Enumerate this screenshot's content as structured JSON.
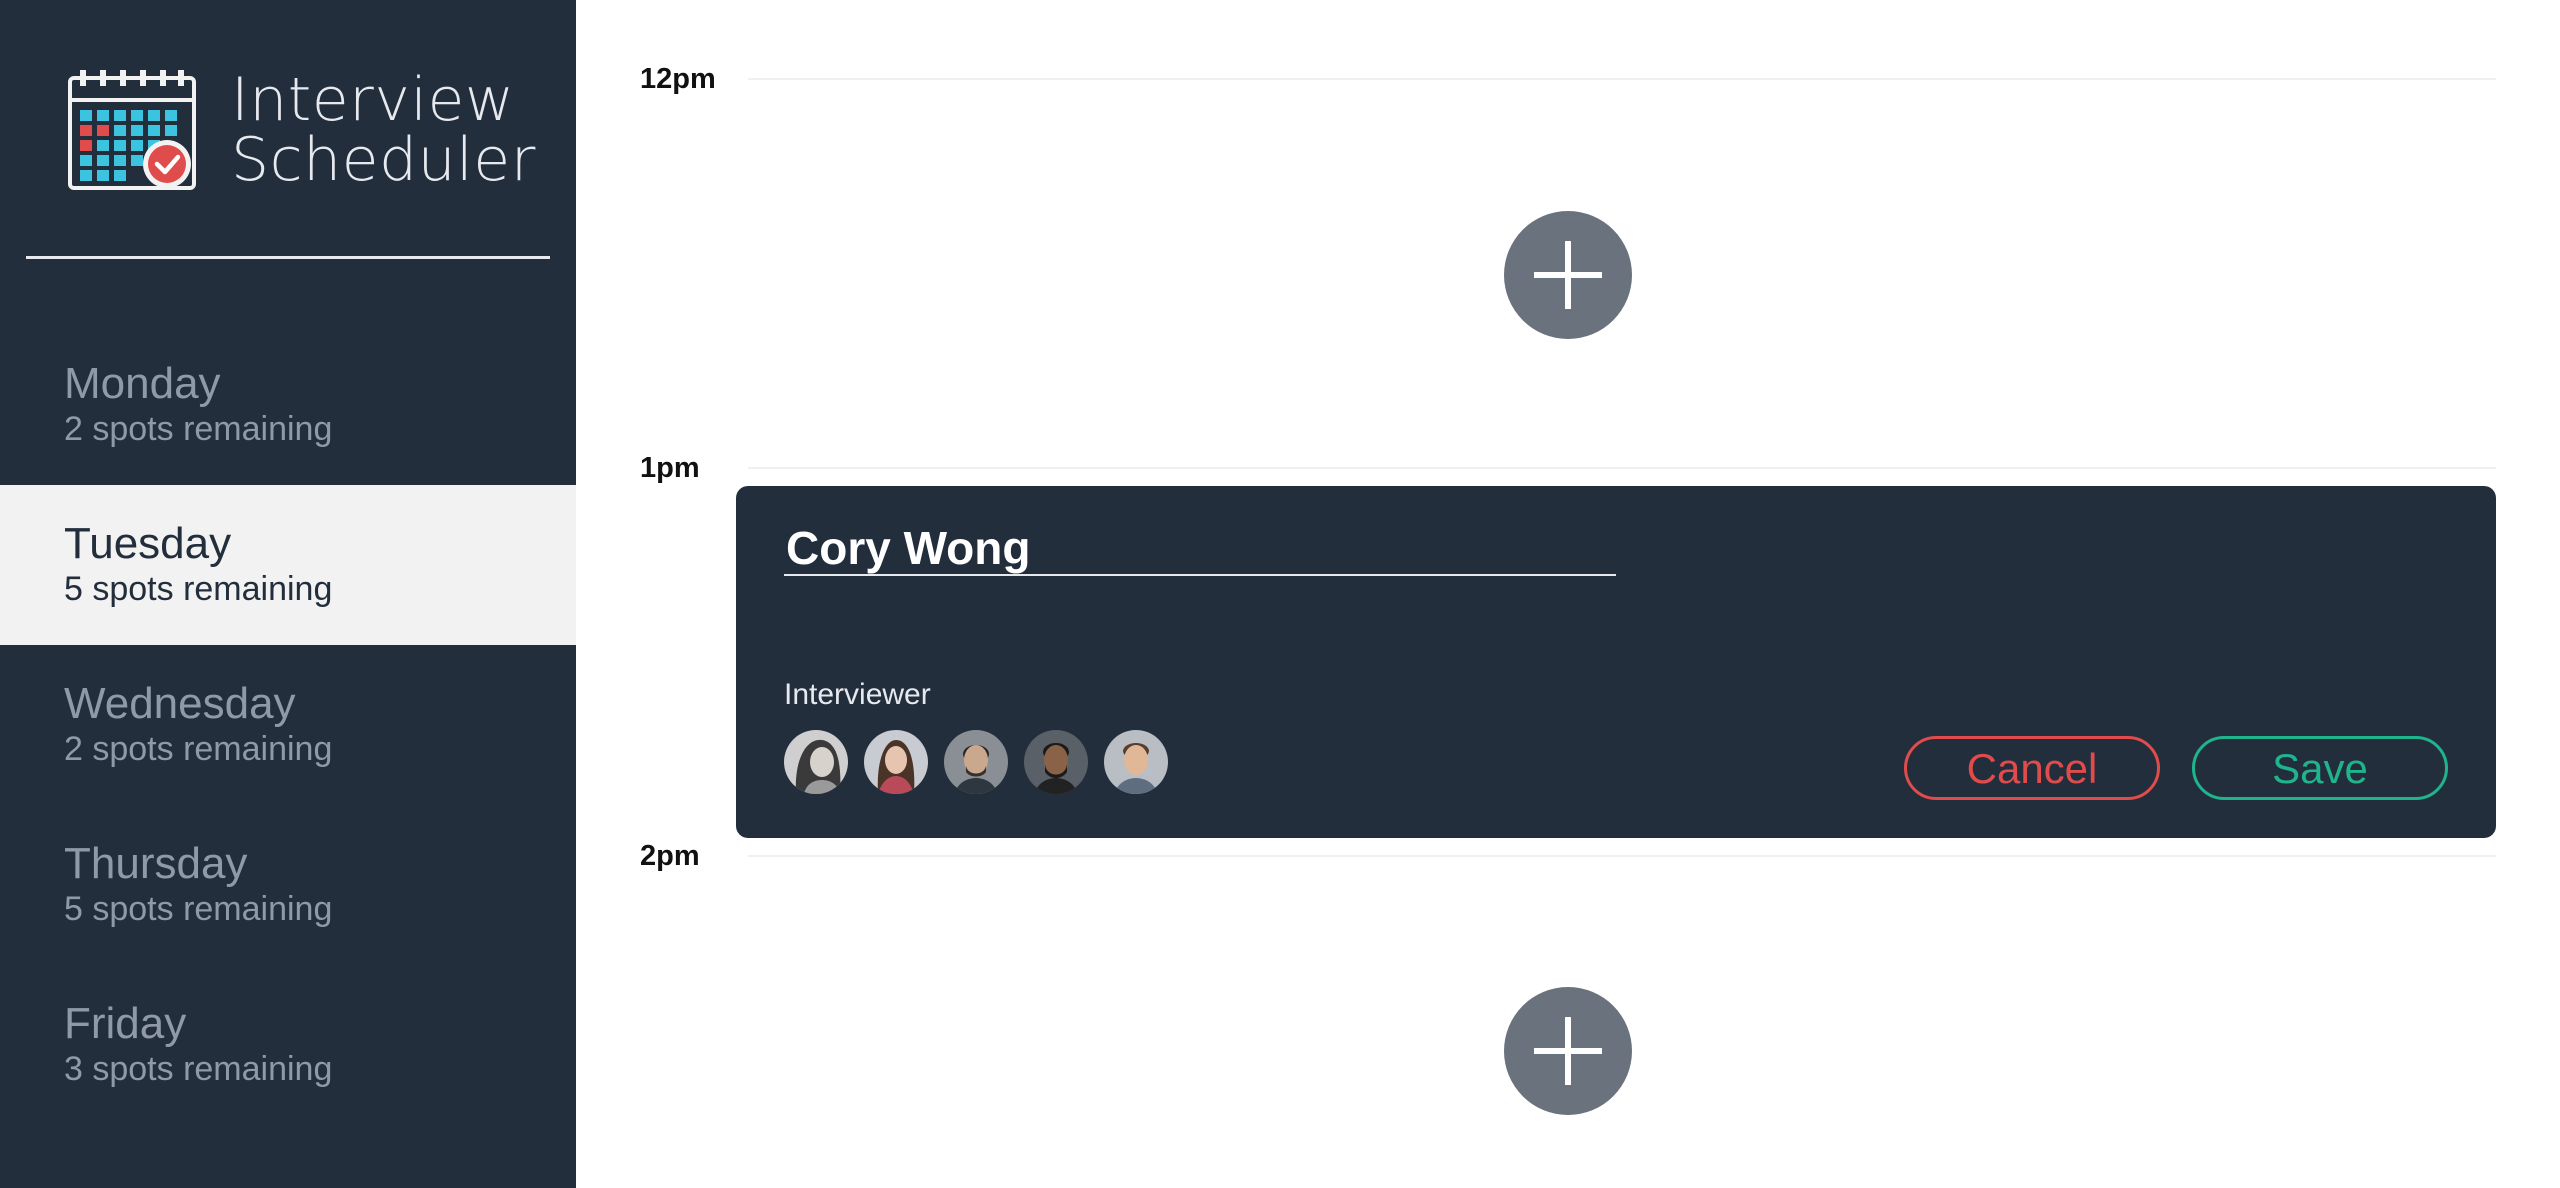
{
  "app": {
    "title": "Interview\nScheduler"
  },
  "sidebar": {
    "days": [
      {
        "name": "Monday",
        "spots": "2 spots remaining",
        "selected": false
      },
      {
        "name": "Tuesday",
        "spots": "5 spots remaining",
        "selected": true
      },
      {
        "name": "Wednesday",
        "spots": "2 spots remaining",
        "selected": false
      },
      {
        "name": "Thursday",
        "spots": "5 spots remaining",
        "selected": false
      },
      {
        "name": "Friday",
        "spots": "3 spots remaining",
        "selected": false
      }
    ]
  },
  "schedule": {
    "times": [
      "12pm",
      "1pm",
      "2pm"
    ]
  },
  "form": {
    "student_name": "Cory Wong",
    "interviewer_label": "Interviewer",
    "interviewer_count": 5,
    "cancel_label": "Cancel",
    "save_label": "Save"
  },
  "icons": {
    "logo": "calendar-check-icon",
    "add": "plus-icon"
  },
  "colors": {
    "sidebar_bg": "#232e3d",
    "selected_day_bg": "#f2f2f2",
    "add_button": "#6a727d",
    "cancel": "#e04b4b",
    "save": "#1fb48b"
  }
}
